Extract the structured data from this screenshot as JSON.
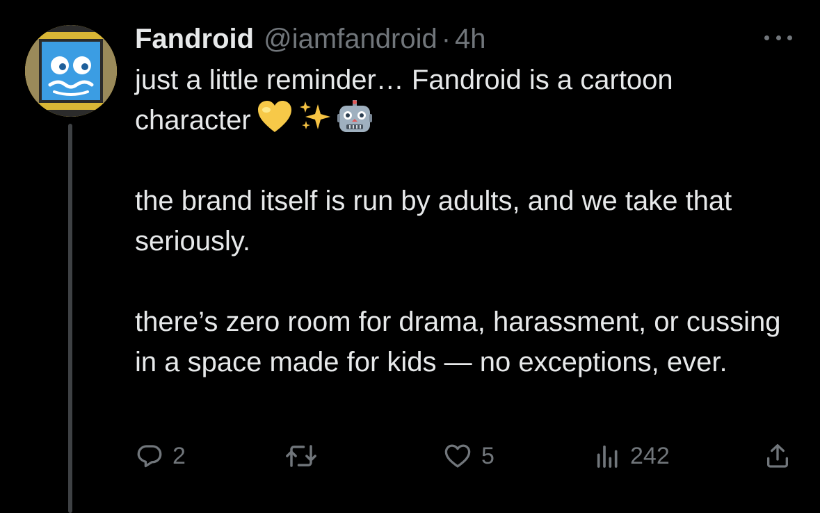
{
  "tweet": {
    "author": {
      "display_name": "Fandroid",
      "handle": "@iamfandroid",
      "separator": "·",
      "time": "4h",
      "avatar_icon": "fandroid-avatar"
    },
    "text": {
      "para1": "just a little reminder… Fandroid is a cartoon character",
      "para1_emojis": [
        "yellow-heart",
        "sparkles",
        "robot"
      ],
      "para2": "the brand itself is run by adults, and we take that seriously.",
      "para3": "there’s zero room for drama, harassment, or cussing in a space made for kids — no exceptions, ever."
    },
    "stats": {
      "replies": "2",
      "likes": "5",
      "views": "242"
    },
    "icons": {
      "more": "more-icon",
      "reply": "reply-icon",
      "retweet": "retweet-icon",
      "like": "heart-icon",
      "views": "views-icon",
      "share": "share-icon"
    },
    "colors": {
      "background": "#000000",
      "text": "#e7e9ea",
      "muted": "#71767b",
      "thread_line": "#3e4144",
      "avatar_border": "#e8c648",
      "avatar_screen": "#3b9de3"
    }
  }
}
